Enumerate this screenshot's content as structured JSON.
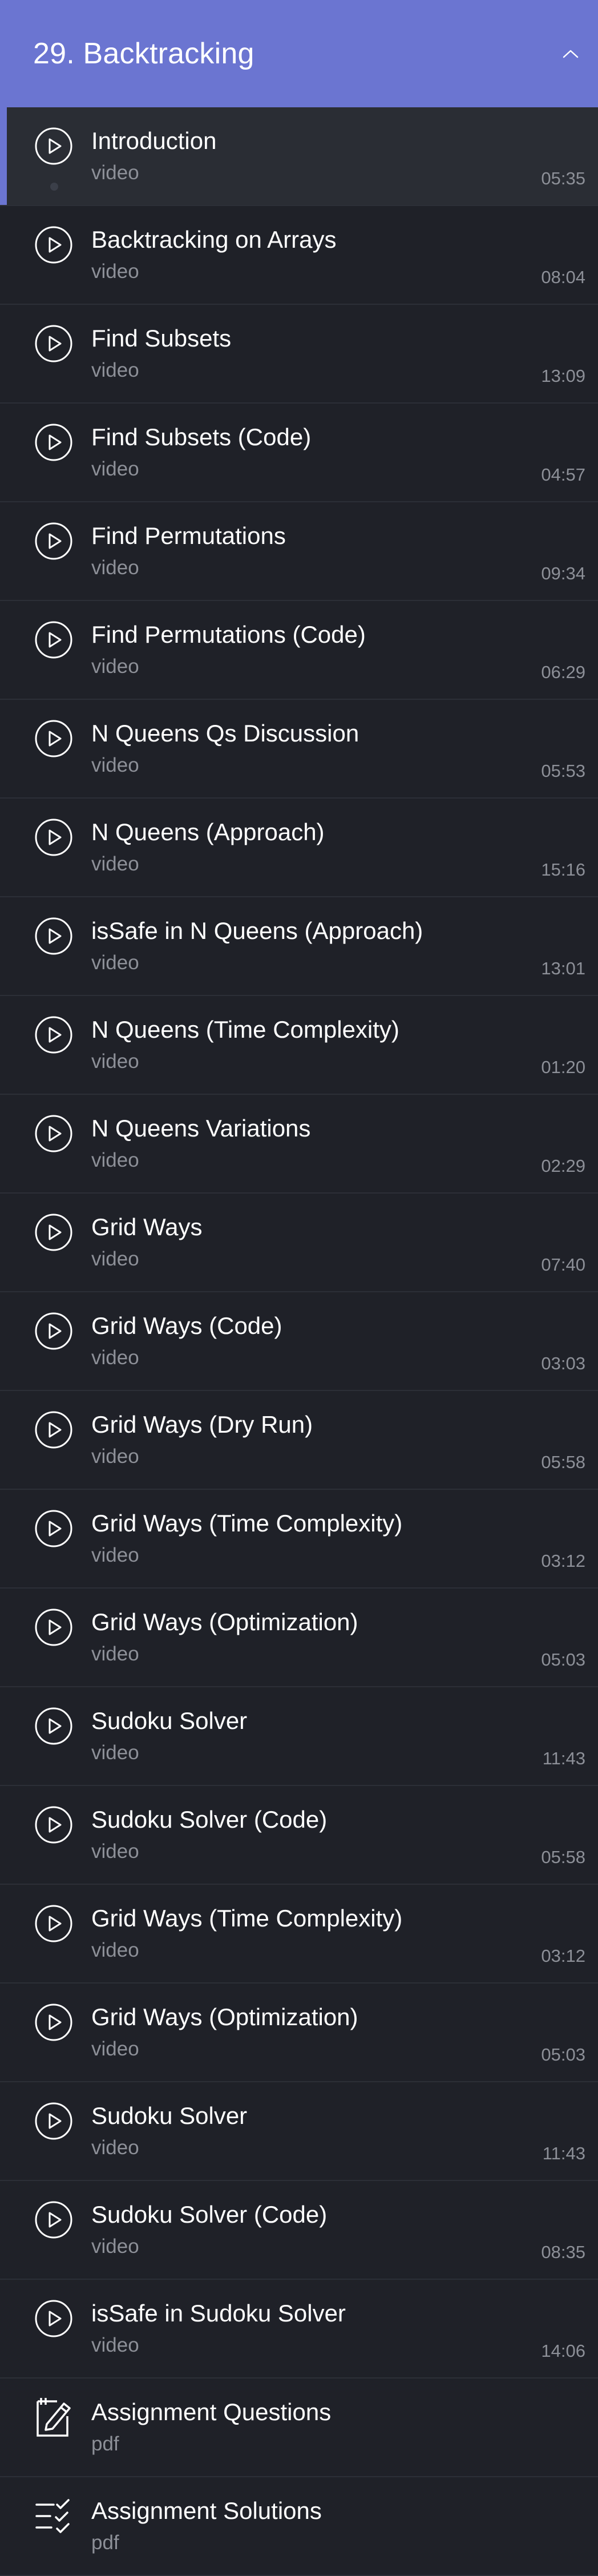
{
  "section": {
    "title": "29. Backtracking"
  },
  "items": [
    {
      "title": "Introduction",
      "type": "video",
      "duration": "05:35",
      "icon": "play-icon"
    },
    {
      "title": "Backtracking on Arrays",
      "type": "video",
      "duration": "08:04",
      "icon": "play-icon"
    },
    {
      "title": "Find Subsets",
      "type": "video",
      "duration": "13:09",
      "icon": "play-icon"
    },
    {
      "title": "Find Subsets (Code)",
      "type": "video",
      "duration": "04:57",
      "icon": "play-icon"
    },
    {
      "title": "Find Permutations",
      "type": "video",
      "duration": "09:34",
      "icon": "play-icon"
    },
    {
      "title": "Find Permutations (Code)",
      "type": "video",
      "duration": "06:29",
      "icon": "play-icon"
    },
    {
      "title": "N Queens Qs Discussion",
      "type": "video",
      "duration": "05:53",
      "icon": "play-icon"
    },
    {
      "title": "N Queens (Approach)",
      "type": "video",
      "duration": "15:16",
      "icon": "play-icon"
    },
    {
      "title": "isSafe in N Queens (Approach)",
      "type": "video",
      "duration": "13:01",
      "icon": "play-icon"
    },
    {
      "title": "N Queens (Time Complexity)",
      "type": "video",
      "duration": "01:20",
      "icon": "play-icon"
    },
    {
      "title": "N Queens Variations",
      "type": "video",
      "duration": "02:29",
      "icon": "play-icon"
    },
    {
      "title": "Grid Ways",
      "type": "video",
      "duration": "07:40",
      "icon": "play-icon"
    },
    {
      "title": "Grid Ways (Code)",
      "type": "video",
      "duration": "03:03",
      "icon": "play-icon"
    },
    {
      "title": "Grid Ways (Dry Run)",
      "type": "video",
      "duration": "05:58",
      "icon": "play-icon"
    },
    {
      "title": "Grid Ways (Time Complexity)",
      "type": "video",
      "duration": "03:12",
      "icon": "play-icon"
    },
    {
      "title": "Grid Ways (Optimization)",
      "type": "video",
      "duration": "05:03",
      "icon": "play-icon"
    },
    {
      "title": "Sudoku Solver",
      "type": "video",
      "duration": "11:43",
      "icon": "play-icon"
    },
    {
      "title": "Sudoku Solver (Code)",
      "type": "video",
      "duration": "05:58",
      "icon": "play-icon"
    },
    {
      "title": "Grid Ways (Time Complexity)",
      "type": "video",
      "duration": "03:12",
      "icon": "play-icon"
    },
    {
      "title": "Grid Ways (Optimization)",
      "type": "video",
      "duration": "05:03",
      "icon": "play-icon"
    },
    {
      "title": "Sudoku Solver",
      "type": "video",
      "duration": "11:43",
      "icon": "play-icon"
    },
    {
      "title": "Sudoku Solver (Code)",
      "type": "video",
      "duration": "08:35",
      "icon": "play-icon"
    },
    {
      "title": "isSafe in Sudoku Solver",
      "type": "video",
      "duration": "14:06",
      "icon": "play-icon"
    },
    {
      "title": "Assignment Questions",
      "type": "pdf",
      "duration": "",
      "icon": "edit-document-icon"
    },
    {
      "title": "Assignment Solutions",
      "type": "pdf",
      "duration": "",
      "icon": "checklist-icon"
    }
  ]
}
